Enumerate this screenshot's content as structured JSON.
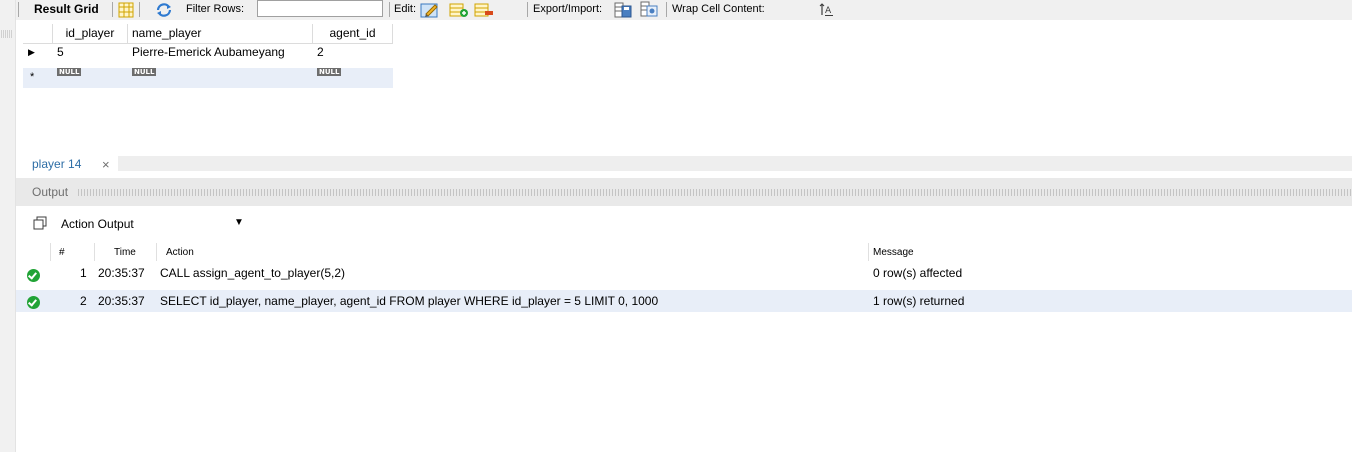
{
  "toolbar": {
    "result_grid_label": "Result Grid",
    "filter_rows_label": "Filter Rows:",
    "filter_value": "",
    "edit_label": "Edit:",
    "export_import_label": "Export/Import:",
    "wrap_cell_label": "Wrap Cell Content:"
  },
  "result_grid": {
    "columns": [
      "id_player",
      "name_player",
      "agent_id"
    ],
    "rows": [
      [
        "5",
        "Pierre-Emerick Aubameyang",
        "2"
      ]
    ],
    "new_row_values": [
      "NULL",
      "NULL",
      "NULL"
    ],
    "new_row_marker": "*",
    "current_row_marker": "▶"
  },
  "tab": {
    "label": "player 14",
    "close": "×"
  },
  "output": {
    "title": "Output",
    "selector_value": "Action Output",
    "columns": {
      "num": "#",
      "time": "Time",
      "action": "Action",
      "message": "Message"
    },
    "rows": [
      {
        "num": "1",
        "time": "20:35:37",
        "action": "CALL assign_agent_to_player(5,2)",
        "message": "0 row(s) affected",
        "status": "success"
      },
      {
        "num": "2",
        "time": "20:35:37",
        "action": "SELECT id_player, name_player, agent_id FROM player WHERE id_player = 5 LIMIT 0, 1000",
        "message": "1 row(s) returned",
        "status": "success"
      }
    ]
  },
  "colors": {
    "success": "#21a336",
    "tab_text": "#2e6ea6",
    "selected_row": "#e8eef8"
  }
}
